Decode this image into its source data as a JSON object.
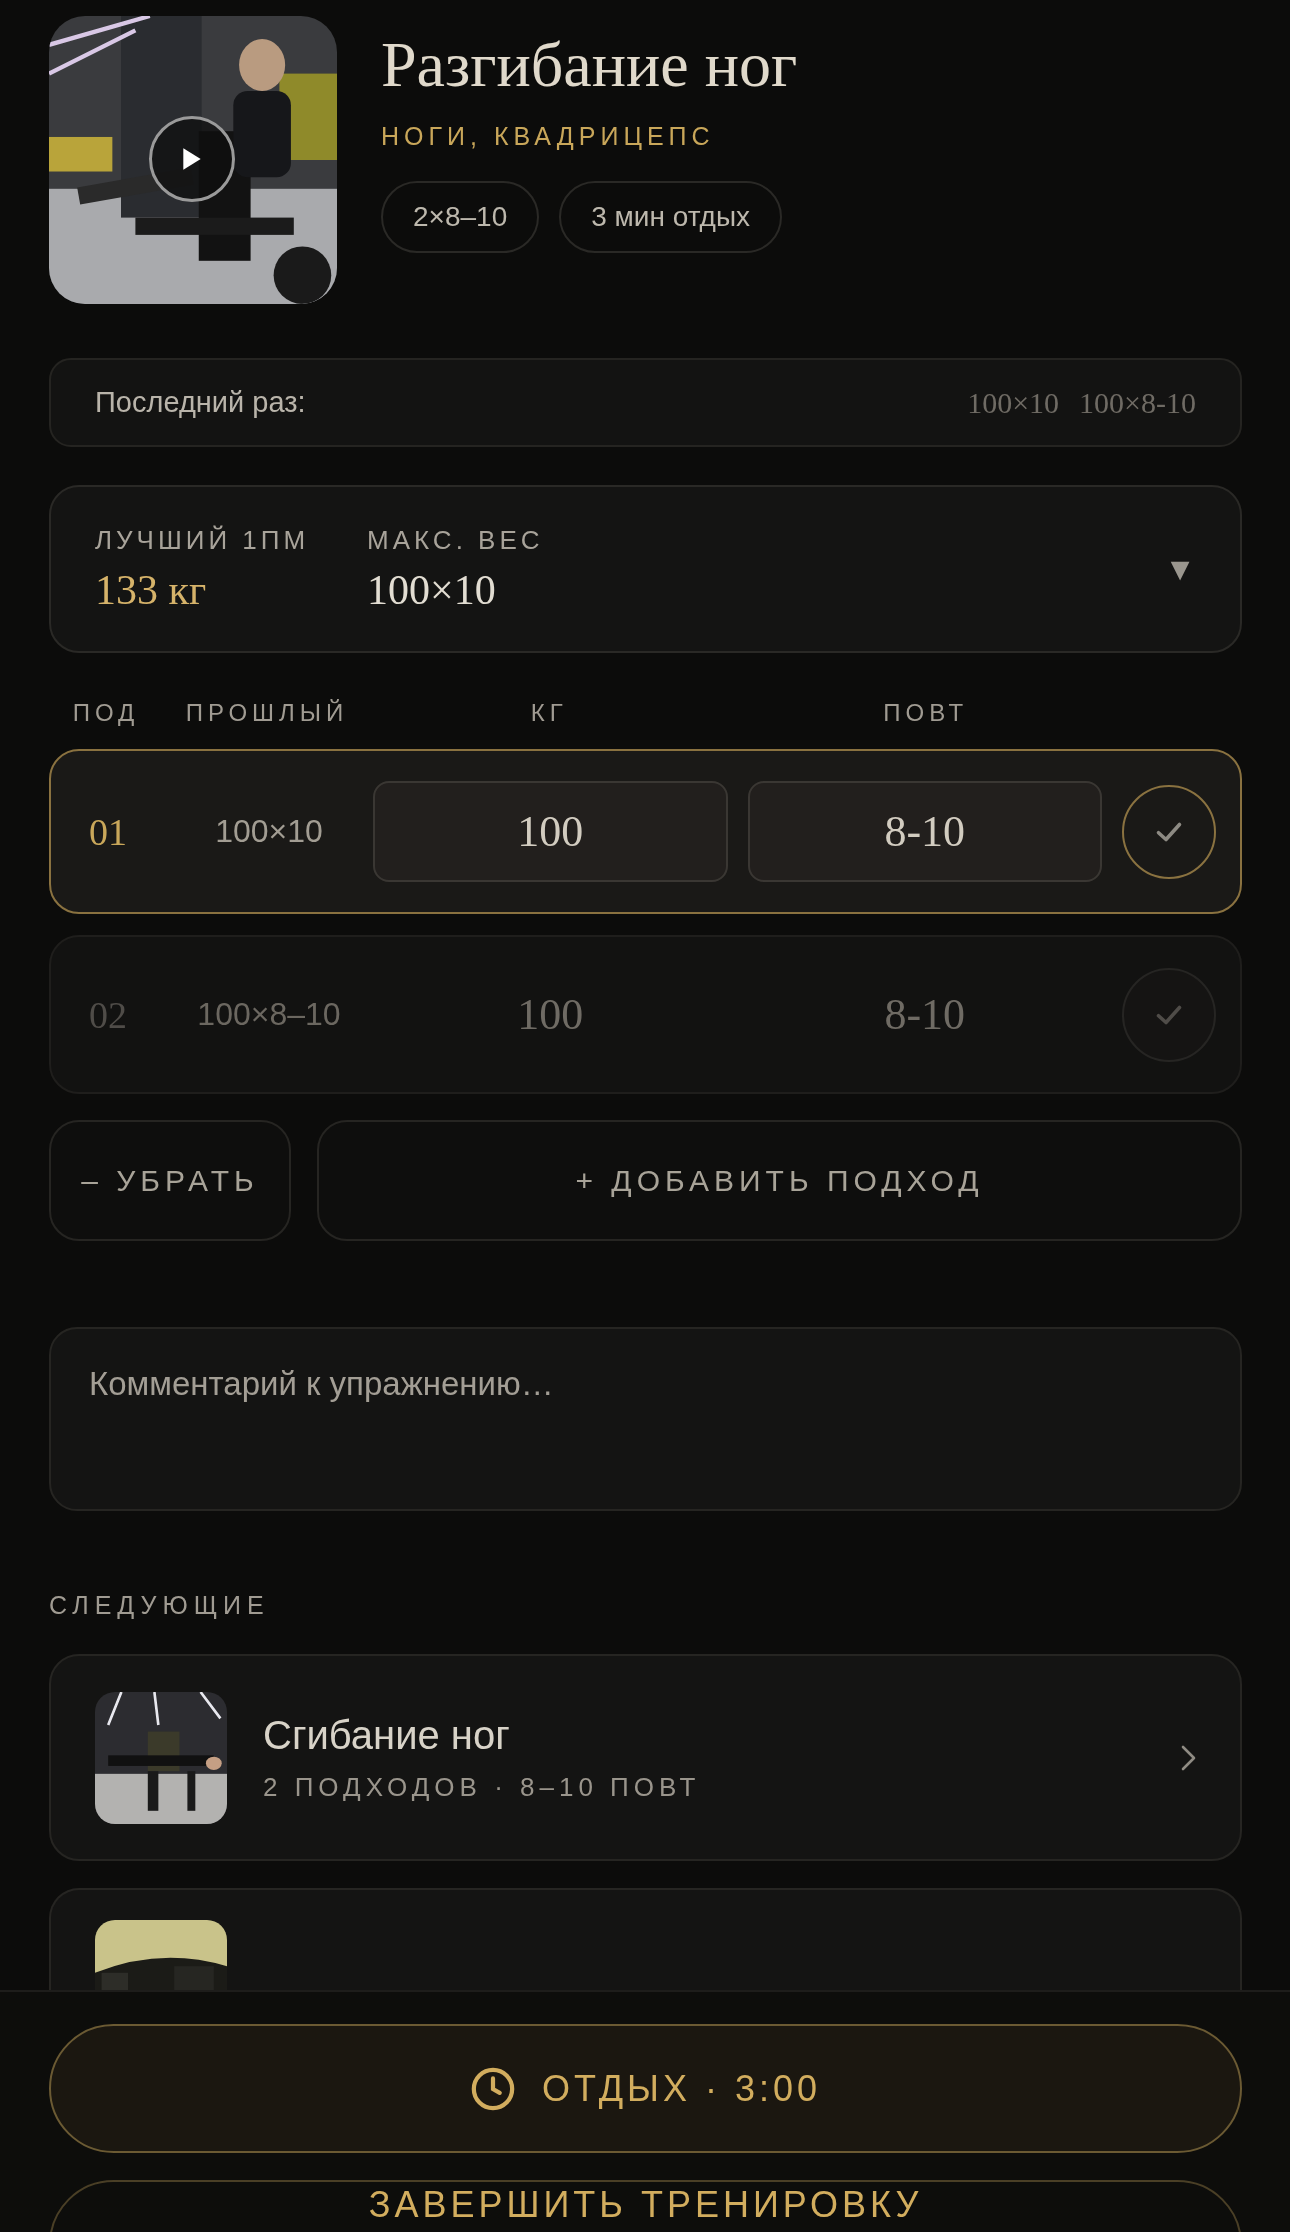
{
  "exercise": {
    "title": "Разгибание ног",
    "muscles": "НОГИ, КВАДРИЦЕПС",
    "video": {
      "kind": "picture"
    },
    "chips": [
      "2×8–10",
      "3 мин отдых"
    ]
  },
  "last_time": {
    "label": "Последний раз:",
    "values": [
      "100×10",
      "100×8-10"
    ]
  },
  "records": {
    "stats": [
      {
        "label": "ЛУЧШИЙ 1ПМ",
        "value": "133 кг",
        "highlight": true
      },
      {
        "label": "МАКС. ВЕС",
        "value": "100×10",
        "highlight": false
      }
    ],
    "toggle": "▼"
  },
  "sets_table": {
    "columns": [
      "ПОД",
      "ПРОШЛЫЙ",
      "КГ",
      "ПОВТ"
    ],
    "rows": [
      {
        "number": "01",
        "previous": "100×10",
        "weight": "100",
        "reps": "8-10",
        "selected": true
      },
      {
        "number": "02",
        "previous": "100×8–10",
        "weight": "100",
        "reps": "8-10",
        "selected": false
      }
    ]
  },
  "set_actions": {
    "remove": "– УБРАТЬ",
    "add": "+ ДОБАВИТЬ ПОДХОД"
  },
  "comment": {
    "placeholder": "Комментарий к упражнению…"
  },
  "next": {
    "heading": "СЛЕДУЮЩИЕ",
    "items": [
      {
        "title": "Сгибание ног",
        "meta": "2 ПОДХОДОВ · 8–10 ПОВТ",
        "thumb": {
          "kind": "picture"
        }
      },
      {
        "thumb": {
          "kind": "picture"
        }
      }
    ]
  },
  "bottom_bar": {
    "rest_button": "ОТДЫХ · 3:00",
    "finish_button": "ЗАВЕРШИТЬ ТРЕНИРОВКУ"
  }
}
